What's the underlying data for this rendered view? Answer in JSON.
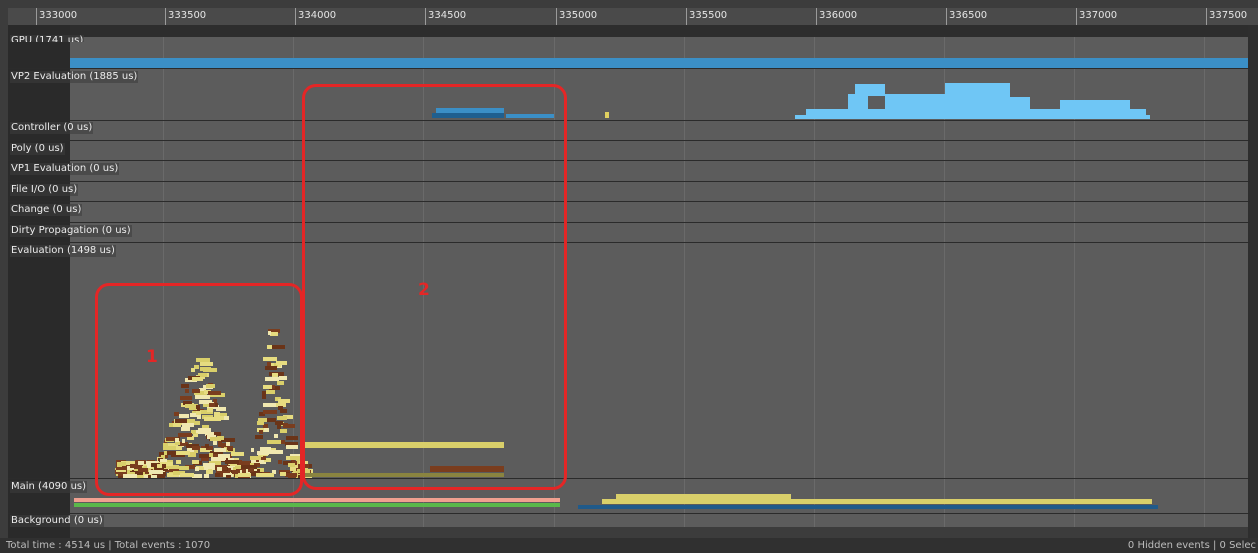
{
  "timeline": {
    "ticks": [
      "333000",
      "333500",
      "334000",
      "334500",
      "335000",
      "335500",
      "336000",
      "336500",
      "337000",
      "337500"
    ]
  },
  "rows": [
    {
      "label": "GPU (1741 us)"
    },
    {
      "label": "VP2 Evaluation (1885 us)"
    },
    {
      "label": "Controller (0 us)"
    },
    {
      "label": "Poly (0 us)"
    },
    {
      "label": "VP1 Evaluation (0 us)"
    },
    {
      "label": "File I/O (0 us)"
    },
    {
      "label": "Change (0 us)"
    },
    {
      "label": "Dirty Propagation (0 us)"
    },
    {
      "label": "Evaluation (1498 us)"
    },
    {
      "label": "Main (4090 us)"
    },
    {
      "label": "Background (0 us)"
    }
  ],
  "annotations": {
    "box1_label": "1",
    "box2_label": "2"
  },
  "status": {
    "left": "Total time : 4514 us | Total events : 1070",
    "right": "0 Hidden events | 0 Selec"
  },
  "colors": {
    "annotation": "#e42626",
    "gpu": "#3b8fc6",
    "vp2": "#6fc6f5",
    "eval_light": "#d9cf6a",
    "eval_dark": "#7a3d1e",
    "main_pink": "#f0a090",
    "main_green": "#5ab84a",
    "main_blue": "#205a8a"
  }
}
